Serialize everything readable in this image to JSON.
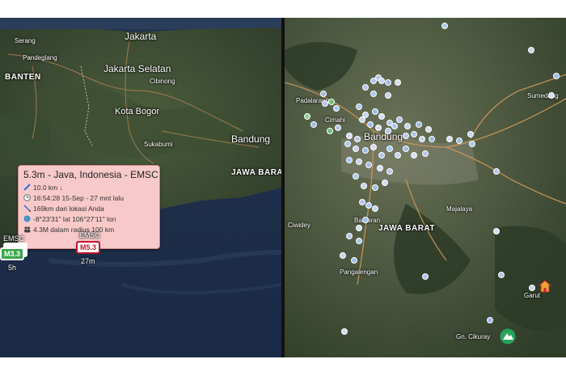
{
  "left_map": {
    "labels": {
      "jakarta": "Jakarta",
      "jakarta_selatan": "Jakarta Selatan",
      "serang": "Serang",
      "pandeglang": "Pandeglang",
      "banten": "BANTEN",
      "kota_bogor": "Kota Bogor",
      "cibinong": "Cibinong",
      "bandung": "Bandung",
      "jawa_barat": "JAWA BARAT",
      "sukabumi": "Sukabumi"
    },
    "popup": {
      "title": "5.3m - Java, Indonesia - EMSC",
      "depth": "10.0 km ↓",
      "time": "16:54:28 15-Sep - 27 mnt lalu",
      "distance": "169km dari lokasi Anda",
      "coordinates": "-8°23'31\" lat 106°27'11\" lon",
      "population": "4.3M dalam radius 100 km"
    },
    "markers": {
      "main_source": "EMSC",
      "main_mag": "M5.3",
      "main_age": "27m",
      "second_source": "EMSC",
      "second_mag": "M3.3",
      "second_age": "5h"
    },
    "colors": {
      "main_border": "#c0142a",
      "second_bg": "#3aa64a"
    }
  },
  "right_map": {
    "labels": {
      "bandung": "Bandung",
      "jawa_barat": "JAWA BARAT",
      "padalarang": "Padalarang",
      "cimahi": "Cimahi",
      "ciwidey": "Ciwidey",
      "pangalengan": "Pangalengan",
      "banjaran": "Banjaran",
      "majalaya": "Majalaya",
      "sumedang": "Sumedang",
      "garut": "Garut",
      "cikuray": "Gn. Cikuray"
    },
    "icons": {
      "house": "house-icon",
      "mountain": "mountain-icon"
    }
  }
}
